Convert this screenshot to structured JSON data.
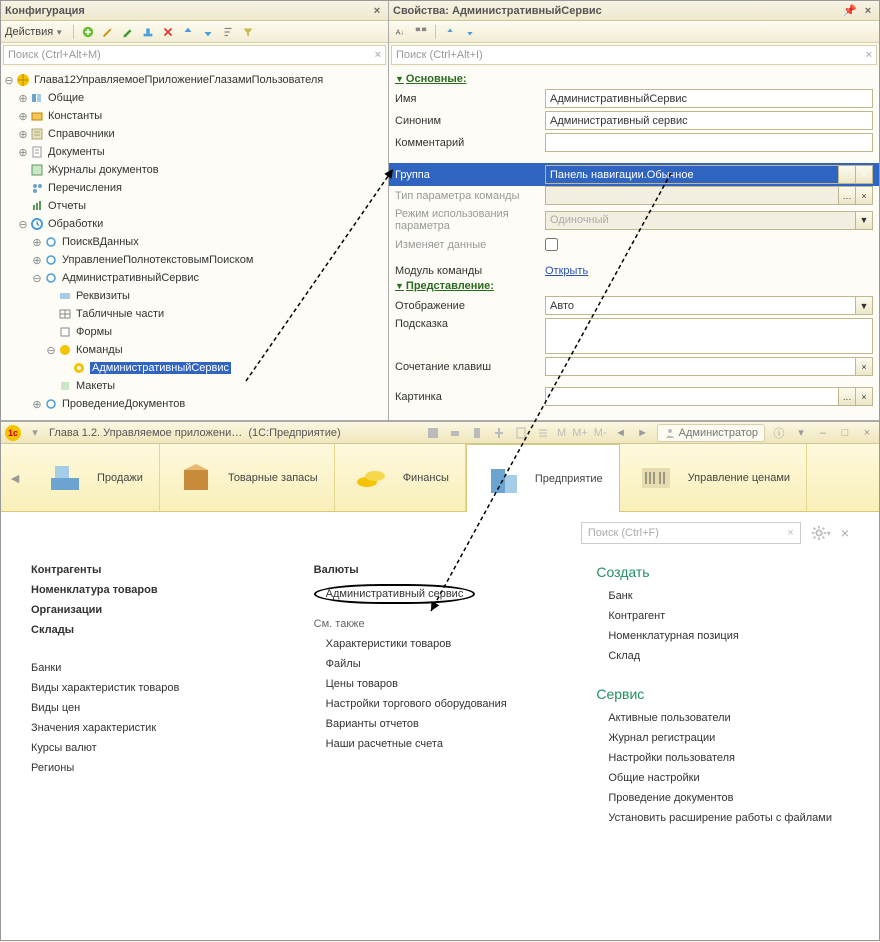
{
  "left": {
    "title": "Конфигурация",
    "actions_label": "Действия",
    "search_placeholder": "Поиск (Ctrl+Alt+M)",
    "tree": [
      {
        "label": "Глава12УправляемоеПриложениеГлазамиПользователя"
      },
      {
        "label": "Общие"
      },
      {
        "label": "Константы"
      },
      {
        "label": "Справочники"
      },
      {
        "label": "Документы"
      },
      {
        "label": "Журналы документов"
      },
      {
        "label": "Перечисления"
      },
      {
        "label": "Отчеты"
      },
      {
        "label": "Обработки"
      },
      {
        "label": "ПоискВДанных"
      },
      {
        "label": "УправлениеПолнотекстовымПоиском"
      },
      {
        "label": "АдминистративныйСервис"
      },
      {
        "label": "Реквизиты"
      },
      {
        "label": "Табличные части"
      },
      {
        "label": "Формы"
      },
      {
        "label": "Команды"
      },
      {
        "label": "АдминистративныйСервис"
      },
      {
        "label": "Макеты"
      },
      {
        "label": "ПроведениеДокументов"
      }
    ]
  },
  "right": {
    "title": "Свойства: АдминистративныйСервис",
    "search_placeholder": "Поиск (Ctrl+Alt+I)",
    "sections": {
      "main": "Основные:",
      "pres": "Представление:"
    },
    "fields": {
      "name_label": "Имя",
      "name_value": "АдминистративныйСервис",
      "syn_label": "Синоним",
      "syn_value": "Административный сервис",
      "comment_label": "Комментарий",
      "comment_value": "",
      "group_label": "Группа",
      "group_value": "Панель навигации.Обычное",
      "paramtype_label": "Тип параметра команды",
      "parammode_label": "Режим использования параметра",
      "parammode_value": "Одиночный",
      "changes_label": "Изменяет данные",
      "module_label": "Модуль команды",
      "module_link": "Открыть",
      "display_label": "Отображение",
      "display_value": "Авто",
      "hint_label": "Подсказка",
      "shortcut_label": "Сочетание клавиш",
      "picture_label": "Картинка"
    }
  },
  "app": {
    "title_left": "Глава 1.2. Управляемое приложени…",
    "title_mid": "(1С:Предприятие)",
    "letters": {
      "m": "M",
      "mplus": "M+",
      "mminus": "M-"
    },
    "user": "Администратор",
    "sections": [
      {
        "label": "Продажи"
      },
      {
        "label": "Товарные запасы"
      },
      {
        "label": "Финансы"
      },
      {
        "label": "Предприятие"
      },
      {
        "label": "Управление ценами"
      }
    ],
    "search_placeholder": "Поиск (Ctrl+F)",
    "col1": [
      {
        "text": "Контрагенты",
        "bold": true
      },
      {
        "text": "Номенклатура товаров",
        "bold": true
      },
      {
        "text": "Организации",
        "bold": true
      },
      {
        "text": "Склады",
        "bold": true
      },
      {
        "text": "Банки"
      },
      {
        "text": "Виды характеристик товаров"
      },
      {
        "text": "Виды цен"
      },
      {
        "text": "Значения характеристик"
      },
      {
        "text": "Курсы валют"
      },
      {
        "text": "Регионы"
      }
    ],
    "col2_top": [
      {
        "text": "Валюты",
        "bold": true
      },
      {
        "text": "Административный сервис",
        "circled": true
      }
    ],
    "col2_sub": "См. также",
    "col2_items": [
      {
        "text": "Характеристики товаров"
      },
      {
        "text": "Файлы"
      },
      {
        "text": "Цены товаров"
      },
      {
        "text": "Настройки торгового оборудования"
      },
      {
        "text": "Варианты отчетов"
      },
      {
        "text": "Наши расчетные счета"
      }
    ],
    "col3_create": "Создать",
    "col3_create_items": [
      "Банк",
      "Контрагент",
      "Номенклатурная позиция",
      "Склад"
    ],
    "col3_service": "Сервис",
    "col3_service_items": [
      "Активные пользователи",
      "Журнал регистрации",
      "Настройки пользователя",
      "Общие настройки",
      "Проведение документов",
      "Установить расширение работы с файлами"
    ]
  }
}
